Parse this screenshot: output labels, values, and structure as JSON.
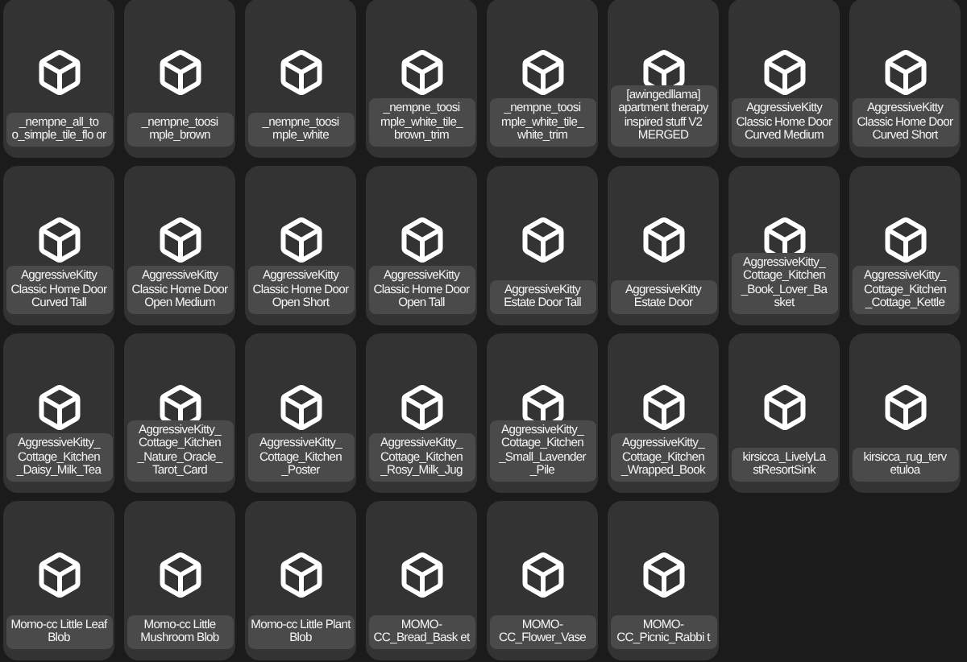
{
  "items": [
    {
      "label": "_nempne_all_to o_simple_tile_flo or"
    },
    {
      "label": "_nempne_toosi mple_brown"
    },
    {
      "label": "_nempne_toosi mple_white"
    },
    {
      "label": "_nempne_toosi mple_white_tile_ brown_trim"
    },
    {
      "label": "_nempne_toosi mple_white_tile_ white_trim"
    },
    {
      "label": "[awingedllama] apartment therapy inspired stuff V2 MERGED"
    },
    {
      "label": "AggressiveKitty Classic Home Door Curved Medium"
    },
    {
      "label": "AggressiveKitty Classic Home Door Curved Short"
    },
    {
      "label": "AggressiveKitty Classic Home Door Curved Tall"
    },
    {
      "label": "AggressiveKitty Classic Home Door Open Medium"
    },
    {
      "label": "AggressiveKitty Classic Home Door Open Short"
    },
    {
      "label": "AggressiveKitty Classic Home Door Open Tall"
    },
    {
      "label": "AggressiveKitty Estate Door Tall"
    },
    {
      "label": "AggressiveKitty Estate Door"
    },
    {
      "label": "AggressiveKitty_ Cottage_Kitchen _Book_Lover_Ba sket"
    },
    {
      "label": "AggressiveKitty_ Cottage_Kitchen _Cottage_Kettle"
    },
    {
      "label": "AggressiveKitty_ Cottage_Kitchen _Daisy_Milk_Tea"
    },
    {
      "label": "AggressiveKitty_ Cottage_Kitchen _Nature_Oracle_ Tarot_Card"
    },
    {
      "label": "AggressiveKitty_ Cottage_Kitchen _Poster"
    },
    {
      "label": "AggressiveKitty_ Cottage_Kitchen _Rosy_Milk_Jug"
    },
    {
      "label": "AggressiveKitty_ Cottage_Kitchen _Small_Lavender _Pile"
    },
    {
      "label": "AggressiveKitty_ Cottage_Kitchen _Wrapped_Book"
    },
    {
      "label": "kirsicca_LivelyLa stResortSink"
    },
    {
      "label": "kirsicca_rug_terv etuloa"
    },
    {
      "label": "Momo-cc Little Leaf Blob"
    },
    {
      "label": "Momo-cc Little Mushroom Blob"
    },
    {
      "label": "Momo-cc Little Plant Blob"
    },
    {
      "label": "MOMO- CC_Bread_Bask et"
    },
    {
      "label": "MOMO- CC_Flower_Vase"
    },
    {
      "label": "MOMO- CC_Picnic_Rabbi t"
    }
  ]
}
